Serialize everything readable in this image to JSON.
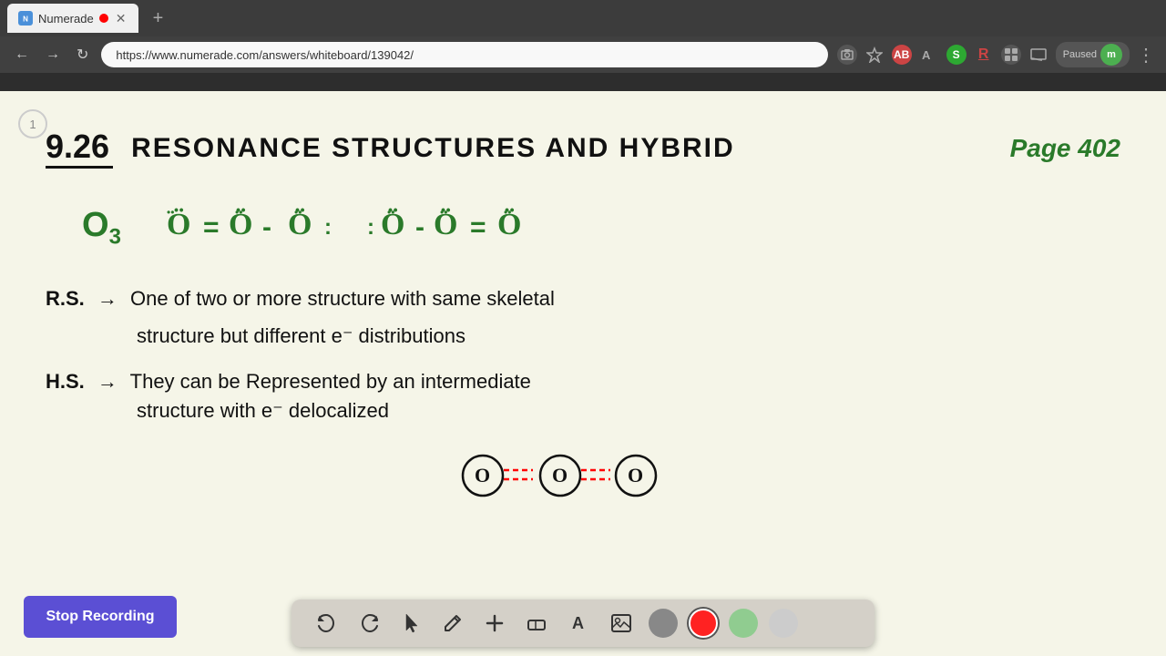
{
  "browser": {
    "tab_title": "Numerade",
    "tab_favicon": "N",
    "url": "https://www.numerade.com/answers/whiteboard/139042/",
    "paused_label": "Paused",
    "new_tab_icon": "+",
    "back_icon": "←",
    "forward_icon": "→",
    "refresh_icon": "↻",
    "page_number": "1",
    "user_initial": "m"
  },
  "whiteboard": {
    "problem_number": "9.26",
    "title": "Resonance Structures and Hybrid",
    "page_ref": "Page 402",
    "molecule_label": "O₃",
    "rs_label": "R.S.",
    "rs_arrow": "→",
    "rs_definition_line1": "One of two or more structure with same skeletal",
    "rs_definition_line2": "structure but different e⁻ distributions",
    "hs_label": "H.S.",
    "hs_arrow": "→",
    "hs_definition_line1": "They can be Represented by an intermediate",
    "hs_definition_line2": "structure with e⁻ delocalized"
  },
  "toolbar": {
    "undo_label": "↺",
    "redo_label": "↻",
    "select_label": "▲",
    "pencil_label": "✏",
    "add_label": "+",
    "eraser_label": "◈",
    "text_label": "A",
    "image_label": "🖼",
    "colors": [
      "#888888",
      "#ff0000",
      "#90cc90",
      "#cccccc"
    ],
    "stop_recording_label": "Stop Recording"
  },
  "icons": {
    "undo": "↺",
    "redo": "↻",
    "cursor": "⬆",
    "pencil": "✎",
    "plus": "+",
    "eraser": "⌫",
    "text": "A",
    "image": "▣"
  }
}
